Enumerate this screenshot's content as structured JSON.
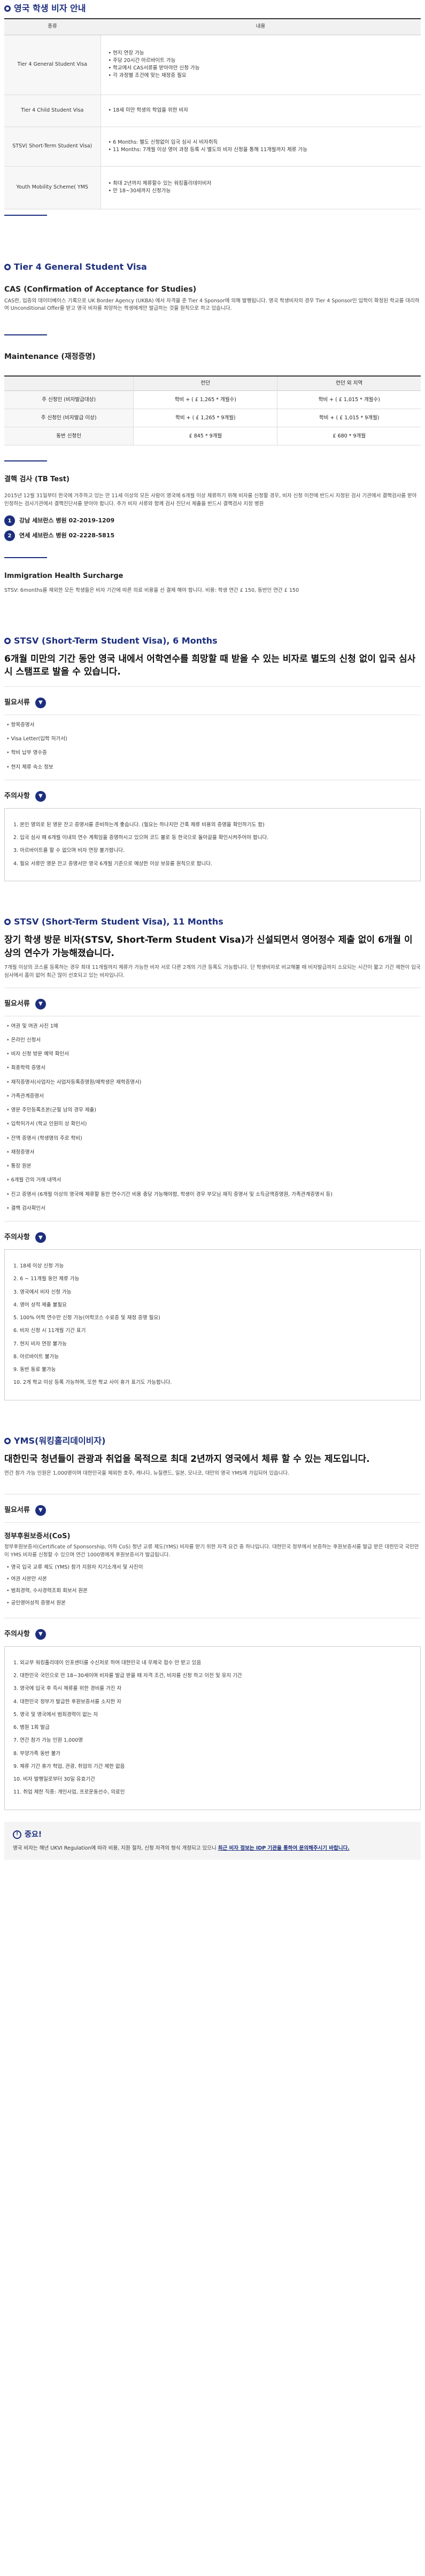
{
  "sections": {
    "student_visa_guide": {
      "title": "영국 학생 비자 안내",
      "table_headers": [
        "종류",
        "내용"
      ],
      "rows": [
        {
          "type": "Tier 4 General Student Visa",
          "items": [
            "현지 연장 가능",
            "주당 20시간 아르바이트 가능",
            "학교에서 CAS서류를 받아야만 신청 가능",
            "각 과정별 조건에 맞는 재정증 필요"
          ]
        },
        {
          "type": "Tier 4 Child Student Visa",
          "items": [
            "18세 미만 학생의 학업을 위한 비자"
          ]
        },
        {
          "type": "STSV( Short-Term Student Visa)",
          "items": [
            "6 Months: 별도 신청없이 입국 심사 시 비자취득",
            "11 Months: 7개월 이상 영어 과정 등록 시 별도의 비자 신청을 통해 11개월까지 체류 가능"
          ]
        },
        {
          "type": "Youth Mobility Scheme( YMS",
          "items": [
            "최대 2년까지 체류할수 있는 워킹홀리데이비자",
            "만 18~30세까지 신청가능"
          ]
        }
      ]
    },
    "tier4": {
      "title": "Tier 4 General Student Visa",
      "cas_title": "CAS (Confirmation of Acceptance for Studies)",
      "cas_text": "CAS란, 입증의 데이터베이스 기록으로 UK Border Agency (UKBA) 에서 자격을 준 Tier 4 Sponsor에 의해 발행됩니다. 영국 학생비자의 경우 Tier 4 Sponsor인 입학이 확정된 학교를 대리하여 Unconditional Offer를 받고 영국 비자를 희망하는 학생에게만 발급하는 것을 원칙으로 하고 있습니다.",
      "maintenance_title": "Maintenance (재정증명)",
      "maintenance_headers": [
        "",
        "런던",
        "런던 외 지역"
      ],
      "maintenance_rows": [
        [
          "주 신청인 (비자발급대상)",
          "학비 + ( £ 1,265 * 개월수)",
          "학비 + ( £ 1,015 * 개월수)"
        ],
        [
          "주 신청인 (비자발급 이상)",
          "학비 + ( £ 1,265 * 9개월)",
          "학비 + ( £ 1,015 * 9개월)"
        ],
        [
          "동반 신청인",
          "£ 845 * 9개월",
          "£ 680 * 9개월"
        ]
      ],
      "tb_title": "결핵 검사 (TB Test)",
      "tb_text": "2015년 12월 31일부터 한국에 거주하고 있는 만 11세 이상의 모든 사람이 영국에 6개월 이상 체류하기 위해 비자를 신청할 경우, 비자 신청 이전에 반드시 지정된 검사 기관에서 결핵검사를 받아 인정하는 검사기관에서 결핵진단서를 받아야 합니다. 추가 비자 서류와 함께 검사 진단서 제출을 반드시 결핵검사 지정 병원",
      "hospitals": [
        "강남 세브란스 병원 02-2019-1209",
        "연세 세브란스 병원 02-2228-5815"
      ],
      "ihs_title": "Immigration Health Surcharge",
      "ihs_text": "STSV: 6months를 제외한 모든 학생들은 비자 기간에 따른 의료 비용을 선 결제 해야 합니다. 비용: 학생 연간 £ 150, 동반인 연간 £ 150"
    },
    "stsv6": {
      "title": "STSV (Short-Term Student Visa), 6 Months",
      "lead": "6개월 미만의 기간 동안 영국 내에서 어학연수를 희망할 때 받을 수 있는 비자로 별도의 신청 없이 입국 심사 시 스탬프로 발을 수 있습니다.",
      "docs_label": "필요서류",
      "docs": [
        "항목증명서",
        "Visa Letter(입학 허가서)",
        "학비 납부 영수증",
        "현지 체류 숙소 정보"
      ],
      "notes_label": "주의사항",
      "notes": [
        "1. 본인 명의로 된 영문 잔고 증명서를 준비하는게 좋습니다. (필요는 하나지만 간혹 체류 비용의 증명을 확인하기도 함)",
        "2. 입국 심사 때 6개월 이내의 연수 계획임을 증명하시고 있으며 코드 볼로 등 한국으로 돌아갈을 확인시켜주어야 합니다.",
        "3. 아르바이트를 할 수 없으며 비자 연장 불가합니다.",
        "4. 필요 서류만 영문 잔고 증명서만 영국 6개월 기준으로 예상한 이상 보유를 원칙으로 합니다."
      ]
    },
    "stsv11": {
      "title": "STSV (Short-Term Student Visa), 11 Months",
      "lead": "장기 학생 방문 비자(STSV, Short-Term Student Visa)가 신설되면서 영어정수 제출 없이 6개월 이상의 연수가 가능해졌습니다.",
      "text": "7개월 이상의 코스를 등록하는 경우 최대 11개월까지 체류가 가능한 비자 서로 다른 2개의 기관 등록도 가능합니다. 단 학생비자로 비교해볼 때 비자발급까지 소요되는 시간이 짧고 기간 제한이 입국 심사에서 흠이 없어 최근 많이 선호되고 있는 비자입니다.",
      "docs_label": "필요서류",
      "docs": [
        "여권 및 여권 사진 1매",
        "온라인 신청서",
        "비자 신청 방문 예약 확인서",
        "최종학력 증명서",
        "재직증명서(사업자는 사업자등록증명원/재학생은 재학증명서)",
        "가족관계증명서",
        "영문 주민등록초본(군필 남의 경우 제출)",
        "입학허가서 (학교 인원미 상 확인서)",
        "잔액 증명서 (학생명의 주로 학비)",
        "재정증명서",
        "통장 원본",
        "6개월 간의 거래 내역서",
        "진고 증명서 (6개월 이상의 영국에 체류할 동안 연수기간 비용 충당 가능해야함, 학생이 경우 부모님 재직 증명서 및 소득금액증명원, 가족관계증명서 등)",
        "결핵 검사확인서"
      ],
      "notes_label": "주의사항",
      "notes": [
        "1. 18세 이상 신청 가능",
        "2. 6 ~ 11개월 동안 체류 가능",
        "3. 영국에서 비자 신청 가능",
        "4. 영어 성적 제출 불필요",
        "5. 100% 어학 연수만 신청 가능(어학코스 수료증 및 재정 증명 필요)",
        "6. 비자 신청 시 11개월 기간 표기",
        "7. 현지 비자 연장 불가능",
        "8. 아르바이트 불가능",
        "9. 동반 동료 불가능",
        "10. 2개 학교 이상 등록 가능하며, 또한 학교 사이 휴가 표기도 가능합니다."
      ]
    },
    "yms": {
      "title": "YMS(워킹홀리데이비자)",
      "lead": "대한민국 청년들이 관광과 취업을 목적으로 최대 2년까지 영국에서 체류 할 수 있는 제도입니다.",
      "text": "연간 참가 가능 인원은 1,000명이며 대한민국을 제외한 호주, 캐나다, 뉴질랜드, 일본, 모나코, 대만의 영국 YMS에 가입되어 있습니다.",
      "docs_label": "필요서류",
      "cos_title": "정부후원보증서(CoS)",
      "cos_text": "정부후원보증서(Certificate of Sponsorship, 이하 CoS) 청년 교류 제도(YMS) 비자를 받기 위한 자격 요건 중 하나입니다. 대한민국 정부에서 보증하는 후원보증서를 발급 받은 대한민국 국민만이 YMS 비자를 신청할 수 있으며 연간 1000명에게 후원보증서가 발급됩니다.",
      "cos_items": [
        "영국 입국 교류 제도 (YMS) 참가 지원자 지기소개서 및 사진이",
        "여권 사본만 사본",
        "범죄경력, 수사경력조회 회보서 원본",
        "공인영어성적 증명서 원본"
      ],
      "notes_label": "주의사항",
      "notes": [
        "1. 외교부 워킹홀리데이 인포센터를 수신처로 하여 대한민국 내 우체국 접수 만 받고 있음",
        "2. 대한민국 국민으로 만 18~30세이며 비자를 발급 받을 때 자격 조건, 비자를 신청 하고 이전 및 유지 기간",
        "3. 영국에 입국 후 즉시 체류를 위한 경비를 가진 자",
        "4. 대한민국 정부가 발급한 후원보증서를 소지한 자",
        "5. 영국 및 영국에서 범죄경력이 없는 자",
        "6. 병원 1회 발급",
        "7. 연간 참가 가능 인원 1,000명",
        "8. 부양가족 동반 불가",
        "9. 체류 기간 휴가 학업, 관광, 취업의 기간 제한 없음",
        "10. 비자 발행일로부터 30일 유효기간",
        "11. 취업 제한 직종: 개인사업, 프로운동선수, 의료인"
      ]
    },
    "warning": {
      "title": "중요!",
      "text": "영국 비자는 해년 UKVI Regulation에 따라 비용, 지원 절차, 신청 자격의 형식 개정되고 있으니",
      "highlight": "최근 비자 정보는 IDP 기관을 통하여 문의해주시기 바랍니다."
    }
  },
  "colors": {
    "accent": "#1c2f7e",
    "header_bg": "#f1f1f1",
    "warn_bg": "#f4f4f4"
  },
  "icons": {
    "section_marker": "circle-marker-icon",
    "accordion": "chevron-down-icon",
    "warning": "exclamation-icon"
  }
}
